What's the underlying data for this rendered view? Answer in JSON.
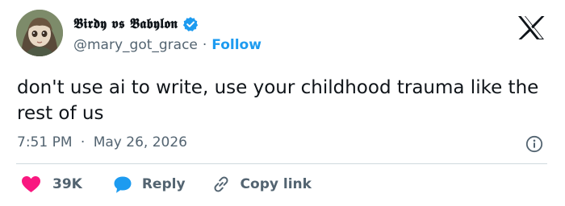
{
  "author": {
    "display_name": "𝕭𝖎𝖗𝖉𝖞 𝖛𝖘 𝕭𝖆𝖇𝖞𝖑𝖔𝖓",
    "handle": "@mary_got_grace",
    "separator": "·",
    "follow_label": "Follow",
    "verified": true
  },
  "tweet": {
    "text": "don't use ai to write, use your childhood trauma like the rest of us",
    "time": "7:51 PM",
    "date": "May 26, 2026"
  },
  "actions": {
    "like_count": "39K",
    "reply_label": "Reply",
    "copy_label": "Copy link"
  },
  "icons": {
    "brand": "x-logo-icon",
    "verified": "verified-badge-icon",
    "info": "info-icon",
    "like": "heart-icon",
    "reply": "reply-bubble-icon",
    "copy": "link-icon"
  },
  "colors": {
    "accent": "#1d9bf0",
    "like": "#f91880",
    "text": "#0f1419",
    "secondary": "#536471",
    "divider": "#cfd9de"
  }
}
